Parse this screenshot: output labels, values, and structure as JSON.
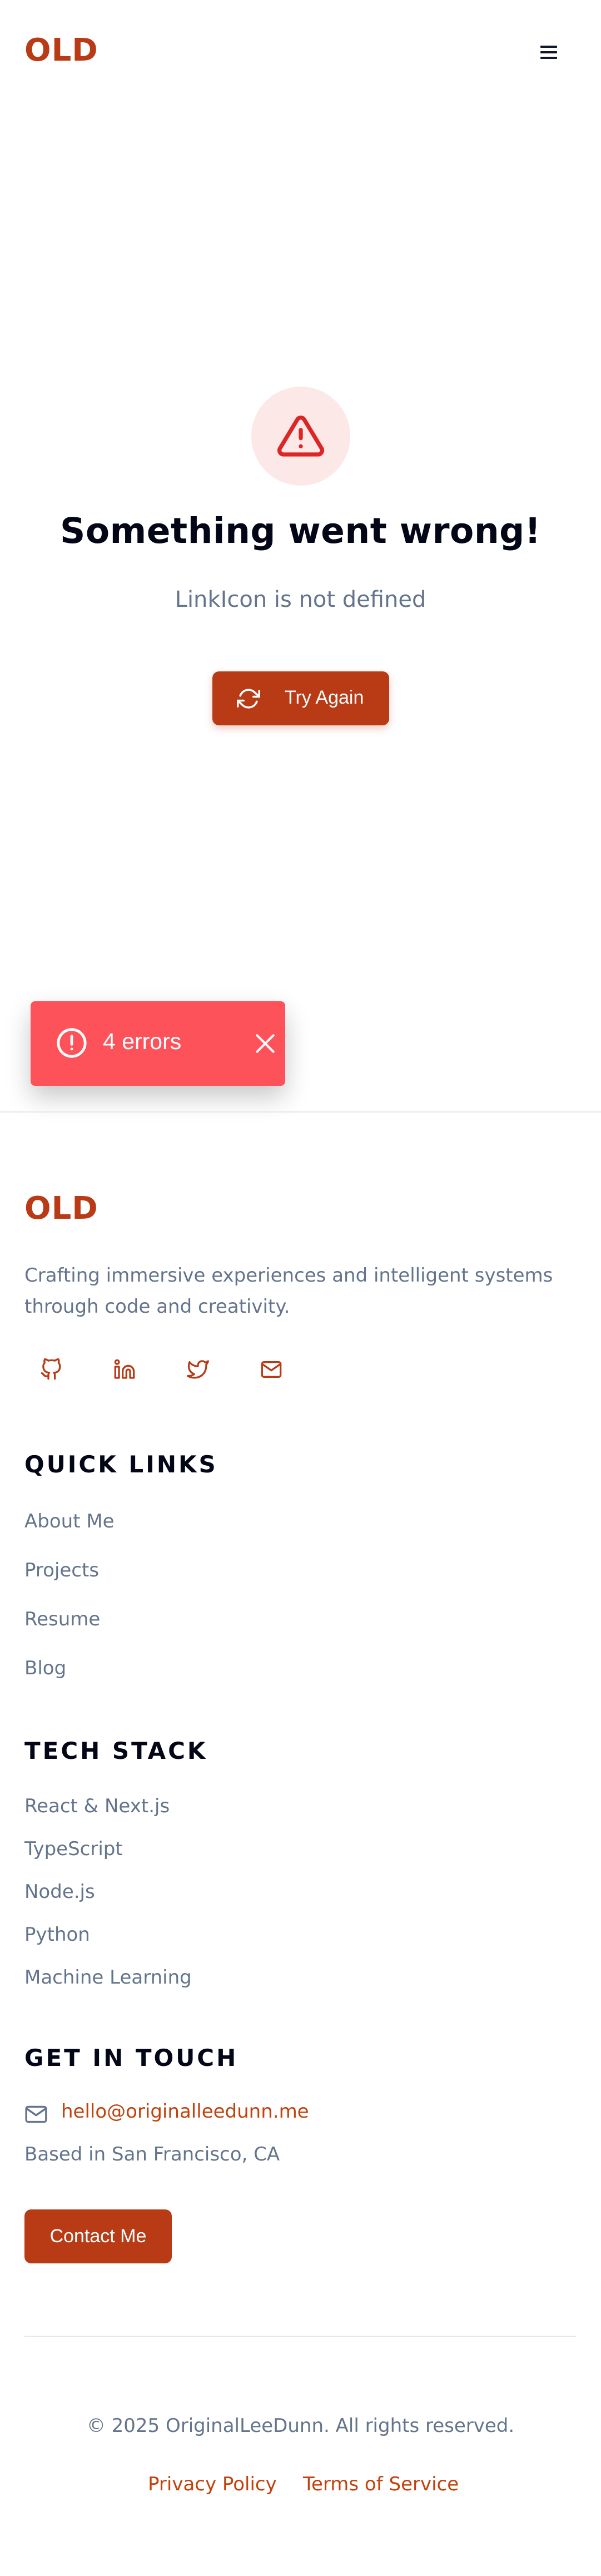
{
  "header": {
    "logo": "OLD",
    "menu_icon": "hamburger-menu-icon"
  },
  "error": {
    "icon": "warning-triangle-icon",
    "title": "Something went wrong!",
    "message": "LinkIcon is not defined",
    "retry_label": "Try Again",
    "retry_icon": "refresh-icon"
  },
  "toast": {
    "icon": "alert-circle-icon",
    "label": "4 errors",
    "close_icon": "close-icon"
  },
  "footer": {
    "logo": "OLD",
    "tagline": "Crafting immersive experiences and intelligent systems through code and creativity.",
    "social": [
      {
        "name": "github",
        "icon": "github-icon"
      },
      {
        "name": "linkedin",
        "icon": "linkedin-icon"
      },
      {
        "name": "twitter",
        "icon": "twitter-icon"
      },
      {
        "name": "email",
        "icon": "mail-icon"
      }
    ],
    "quick_links": {
      "heading": "QUICK LINKS",
      "items": [
        "About Me",
        "Projects",
        "Resume",
        "Blog"
      ]
    },
    "tech_stack": {
      "heading": "TECH STACK",
      "items": [
        "React & Next.js",
        "TypeScript",
        "Node.js",
        "Python",
        "Machine Learning"
      ]
    },
    "contact": {
      "heading": "GET IN TOUCH",
      "email": "hello@originalleedunn.me",
      "location": "Based in San Francisco, CA",
      "button_label": "Contact Me"
    },
    "copyright": "© 2025 OriginalLeeDunn. All rights reserved.",
    "legal": {
      "privacy": "Privacy Policy",
      "terms": "Terms of Service"
    }
  },
  "colors": {
    "accent": "#b83b16",
    "toast": "#fe525a",
    "warning": "#dc2626",
    "heading": "#020617",
    "muted": "#64748b"
  }
}
